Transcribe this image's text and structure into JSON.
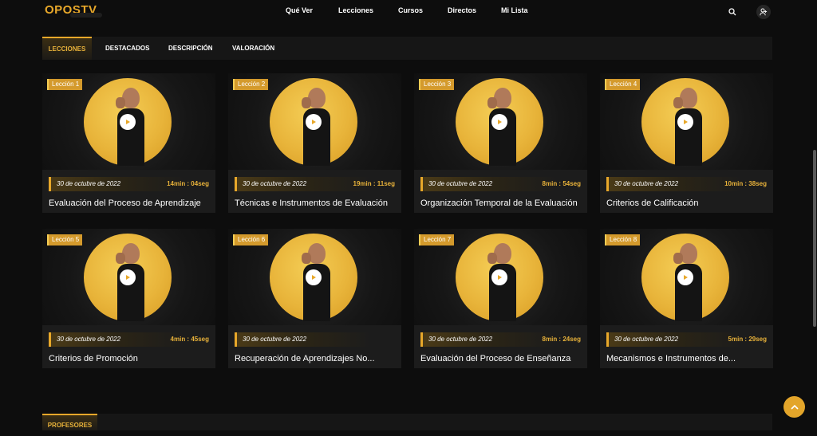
{
  "header": {
    "logo": "OPOSTV",
    "nav": [
      "Qué Ver",
      "Lecciones",
      "Cursos",
      "Directos",
      "Mi Lista"
    ],
    "icons": [
      "search-icon",
      "user-add-icon"
    ]
  },
  "tabs": [
    "LECCIONES",
    "DESTACADOS",
    "DESCRIPCIÓN",
    "VALORACIÓN"
  ],
  "active_tab": "LECCIONES",
  "lessons": [
    {
      "badge": "Lección 1",
      "date": "30 de octubre de 2022",
      "duration": "14min : 04seg",
      "title": "Evaluación del Proceso de Aprendizaje"
    },
    {
      "badge": "Lección 2",
      "date": "30 de octubre de 2022",
      "duration": "19min : 11seg",
      "title": "Técnicas e Instrumentos de Evaluación"
    },
    {
      "badge": "Lección 3",
      "date": "30 de octubre de 2022",
      "duration": "8min : 54seg",
      "title": "Organización Temporal de la Evaluación"
    },
    {
      "badge": "Lección 4",
      "date": "30 de octubre de 2022",
      "duration": "10min : 38seg",
      "title": "Criterios de Calificación"
    },
    {
      "badge": "Lección 5",
      "date": "30 de octubre de 2022",
      "duration": "4min : 45seg",
      "title": "Criterios de Promoción"
    },
    {
      "badge": "Lección 6",
      "date": "30 de octubre de 2022",
      "duration": "",
      "title": "Recuperación de Aprendizajes No..."
    },
    {
      "badge": "Lección 7",
      "date": "30 de octubre de 2022",
      "duration": "8min : 24seg",
      "title": "Evaluación del Proceso de Enseñanza"
    },
    {
      "badge": "Lección 8",
      "date": "30 de octubre de 2022",
      "duration": "5min : 29seg",
      "title": "Mecanismos e Instrumentos de..."
    }
  ],
  "professors_tab": "PROFESORES",
  "colors": {
    "accent": "#e8a82a",
    "background": "#0d0d0d",
    "card": "#1c1c1c"
  },
  "fab_icon": "chevron-up-icon"
}
